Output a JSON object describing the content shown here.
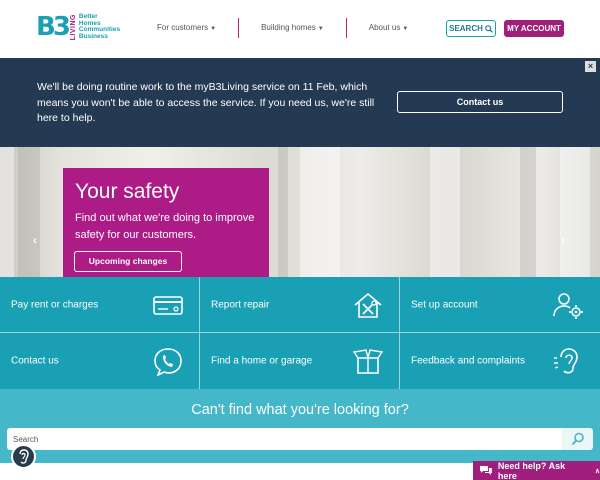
{
  "header": {
    "logo_mark": "B3",
    "logo_vertical": "LIVING",
    "logo_lines": [
      "Better",
      "Homes",
      "Communities",
      "Business"
    ],
    "nav": [
      {
        "label": "For customers"
      },
      {
        "label": "Building homes"
      },
      {
        "label": "About us"
      }
    ],
    "search_label": "SEARCH",
    "account_label": "MY ACCOUNT",
    "accent": "#a01e7c",
    "teal": "#1aa0b4"
  },
  "notice": {
    "text": "We'll be doing routine work to the myB3Living service on 11 Feb, which means you won't be able to access the service. If you need us, we're still here to help.",
    "close_glyph": "×",
    "button_label": "Contact us",
    "background": "#243a52"
  },
  "hero": {
    "title": "Your safety",
    "subtitle": "Find out what we're doing to improve safety for our customers.",
    "button_label": "Upcoming changes",
    "prev_glyph": "‹",
    "next_glyph": "›",
    "card_color": "#ad1c86"
  },
  "tiles": [
    {
      "label": "Pay rent or charges",
      "icon": "card-icon"
    },
    {
      "label": "Report repair",
      "icon": "house-tools-icon"
    },
    {
      "label": "Set up account",
      "icon": "user-gear-icon"
    },
    {
      "label": "Contact us",
      "icon": "phone-bubble-icon"
    },
    {
      "label": "Find a home or garage",
      "icon": "open-box-icon"
    },
    {
      "label": "Feedback and complaints",
      "icon": "ear-icon"
    }
  ],
  "find": {
    "title": "Can't find what you're looking for?",
    "placeholder": "Search"
  },
  "help": {
    "label": "Need help? Ask here",
    "chevron": "∧"
  }
}
